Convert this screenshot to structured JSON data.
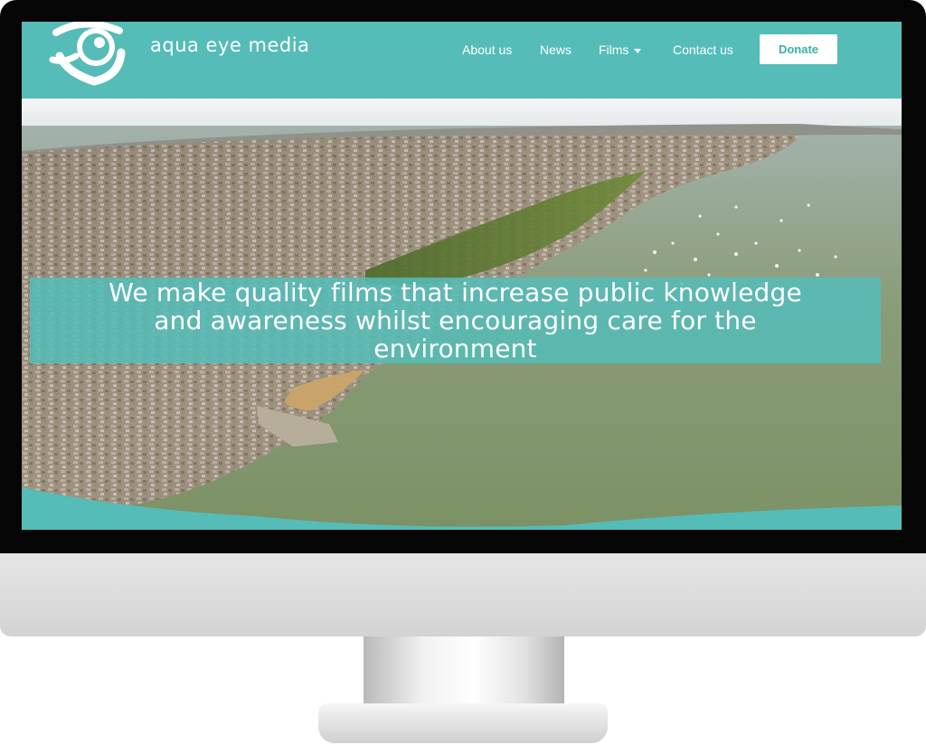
{
  "brand": {
    "name": "aqua eye media",
    "logo_icon": "eye-logo-icon",
    "accent_color": "#55bcb7"
  },
  "nav": {
    "about": "About us",
    "news": "News",
    "films": "Films",
    "films_icon": "caret-down-icon",
    "contact": "Contact us",
    "donate": "Donate"
  },
  "hero": {
    "tagline": "We make quality films that increase public knowledge and awareness whilst encouraging care for the environment",
    "background": "aerial photo of coastal town and estuary"
  }
}
